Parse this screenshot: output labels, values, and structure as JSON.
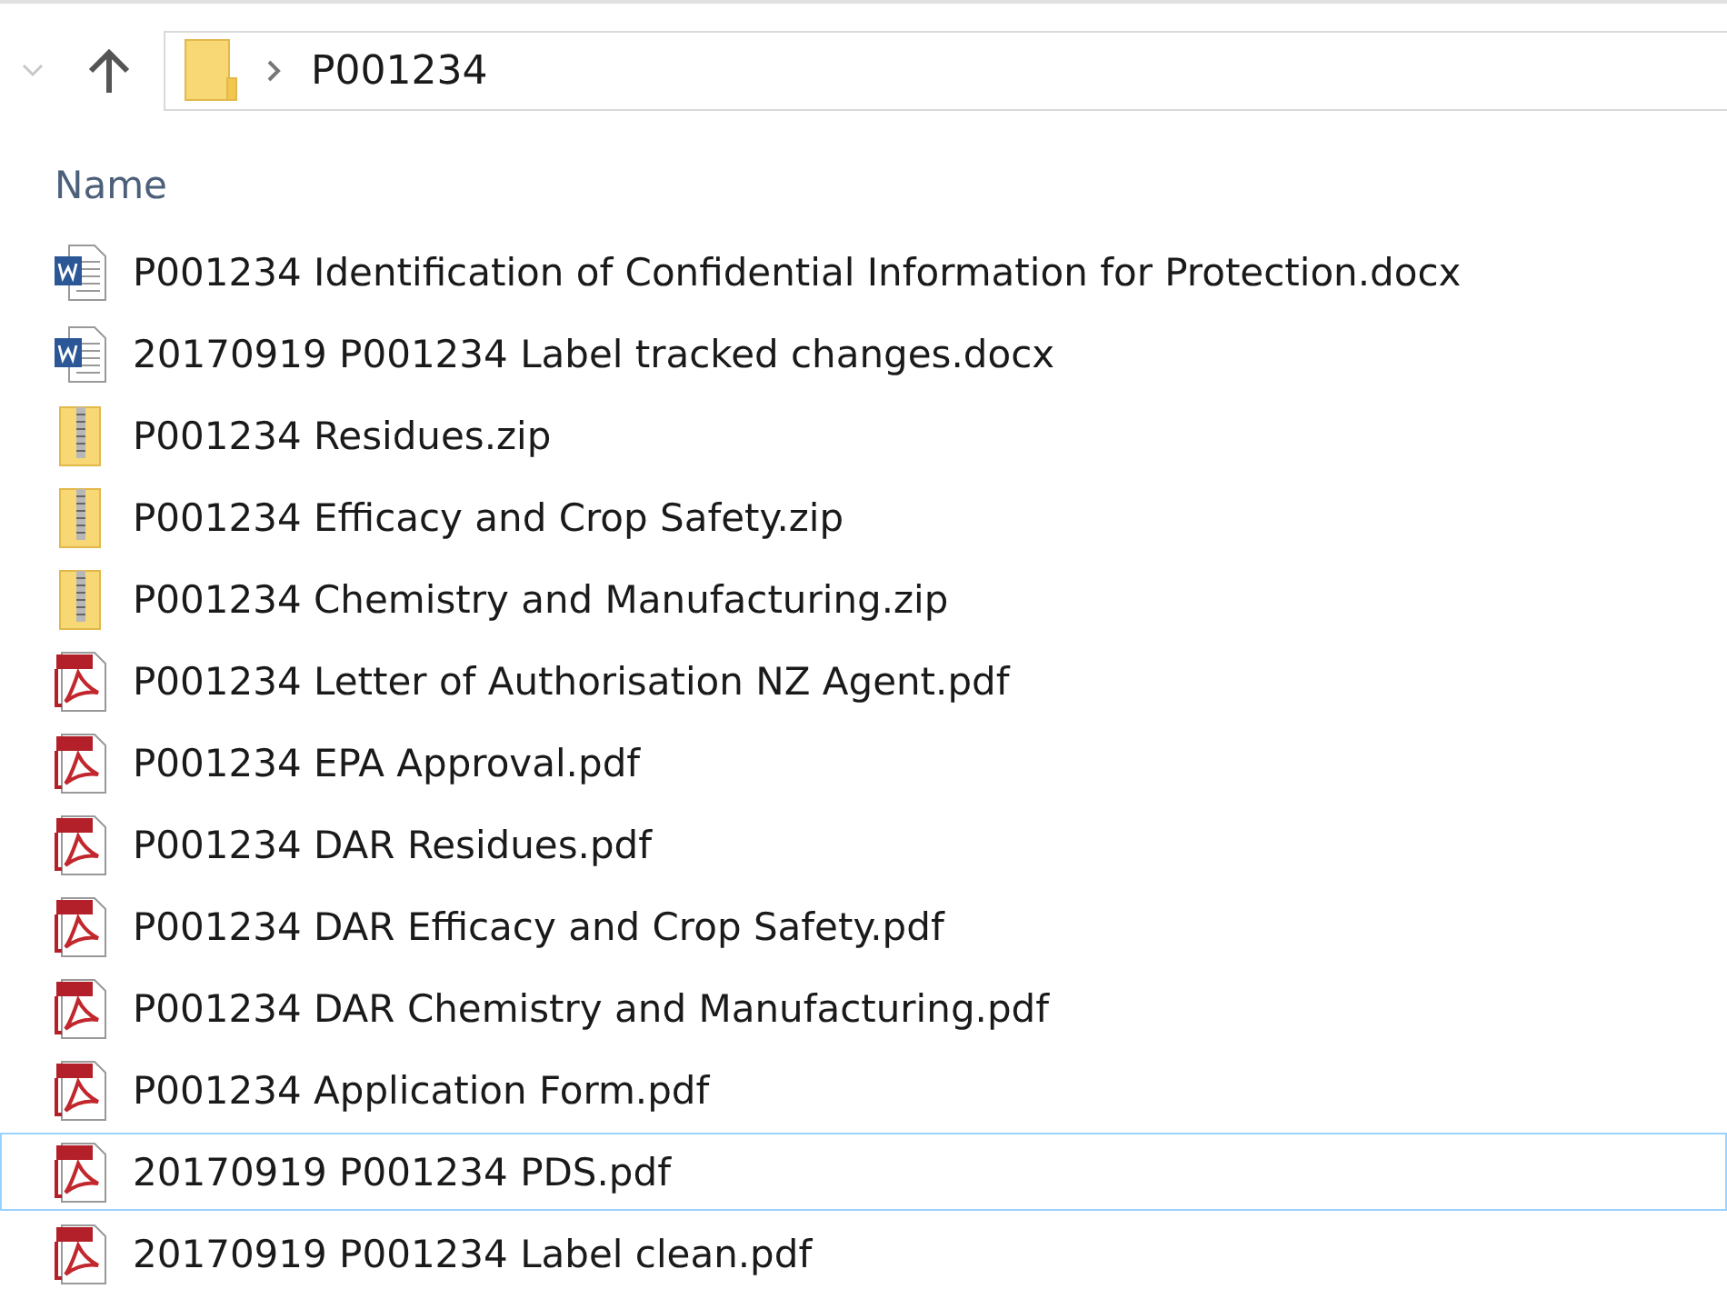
{
  "address_bar": {
    "path": "P001234"
  },
  "column_header": {
    "label": "Name"
  },
  "files": [
    {
      "name": "P001234 Identification of Confidential Information for Protection.docx",
      "kind": "word",
      "focused": false
    },
    {
      "name": "20170919 P001234 Label tracked changes.docx",
      "kind": "word",
      "focused": false
    },
    {
      "name": "P001234 Residues.zip",
      "kind": "zip",
      "focused": false
    },
    {
      "name": "P001234 Efficacy and Crop Safety.zip",
      "kind": "zip",
      "focused": false
    },
    {
      "name": "P001234 Chemistry and Manufacturing.zip",
      "kind": "zip",
      "focused": false
    },
    {
      "name": "P001234 Letter of Authorisation NZ Agent.pdf",
      "kind": "pdf",
      "focused": false
    },
    {
      "name": "P001234 EPA Approval.pdf",
      "kind": "pdf",
      "focused": false
    },
    {
      "name": "P001234 DAR Residues.pdf",
      "kind": "pdf",
      "focused": false
    },
    {
      "name": "P001234 DAR Efficacy and Crop Safety.pdf",
      "kind": "pdf",
      "focused": false
    },
    {
      "name": "P001234 DAR Chemistry and Manufacturing.pdf",
      "kind": "pdf",
      "focused": false
    },
    {
      "name": "P001234 Application Form.pdf",
      "kind": "pdf",
      "focused": false
    },
    {
      "name": "20170919 P001234 PDS.pdf",
      "kind": "pdf",
      "focused": true
    },
    {
      "name": "20170919 P001234 Label clean.pdf",
      "kind": "pdf",
      "focused": false
    }
  ]
}
